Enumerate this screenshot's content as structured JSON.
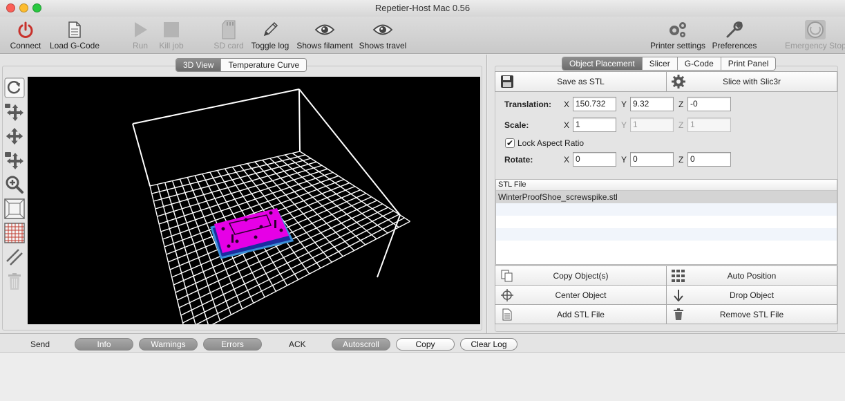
{
  "window": {
    "title": "Repetier-Host Mac 0.56"
  },
  "toolbar": {
    "connect": "Connect",
    "load_gcode": "Load G-Code",
    "run": "Run",
    "kill_job": "Kill job",
    "sd_card": "SD card",
    "toggle_log": "Toggle log",
    "shows_filament": "Shows filament",
    "shows_travel": "Shows travel",
    "printer_settings": "Printer settings",
    "preferences": "Preferences",
    "emergency_stop": "Emergency Stop"
  },
  "left_tabs": {
    "view3d": "3D View",
    "temperature": "Temperature Curve"
  },
  "right_tabs": {
    "object_placement": "Object Placement",
    "slicer": "Slicer",
    "gcode": "G-Code",
    "print_panel": "Print Panel"
  },
  "placement": {
    "save_stl": "Save as STL",
    "slice": "Slice with Slic3r",
    "translation_label": "Translation:",
    "scale_label": "Scale:",
    "rotate_label": "Rotate:",
    "lock_aspect": "Lock Aspect Ratio",
    "ax_x": "X",
    "ax_y": "Y",
    "ax_z": "Z",
    "translation": {
      "x": "150.732",
      "y": "9.32",
      "z": "-0"
    },
    "scale": {
      "x": "1",
      "y": "1",
      "z": "1"
    },
    "rotate": {
      "x": "0",
      "y": "0",
      "z": "0"
    }
  },
  "stl_table": {
    "header": "STL File",
    "files": [
      "WinterProofShoe_screwspike.stl"
    ]
  },
  "actions": {
    "copy": "Copy Object(s)",
    "auto_position": "Auto Position",
    "center": "Center Object",
    "drop": "Drop Object",
    "add_stl": "Add STL File",
    "remove_stl": "Remove STL File"
  },
  "log": {
    "send": "Send",
    "info": "Info",
    "warnings": "Warnings",
    "errors": "Errors",
    "ack": "ACK",
    "autoscroll": "Autoscroll",
    "copy": "Copy",
    "clear": "Clear Log"
  },
  "colors": {
    "object": "#e600e6",
    "grid": "#ffffff",
    "viewport_bg": "#000000",
    "selection": "#3a8fd8"
  }
}
